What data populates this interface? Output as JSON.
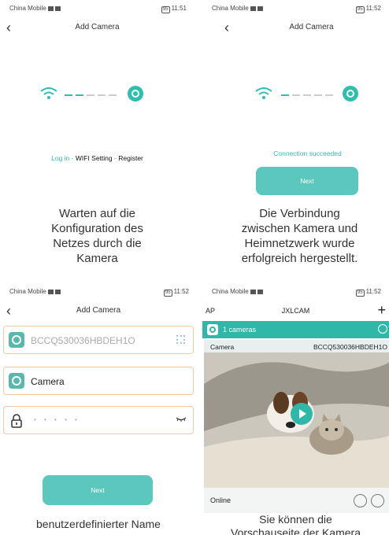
{
  "panel1": {
    "status": {
      "carrier": "China Mobile",
      "time": "11:51",
      "battery": "95"
    },
    "title": "Add Camera",
    "steps": {
      "login": "Log in",
      "wifi": "WIFI Setting",
      "register": "Register",
      "separator": "-"
    },
    "caption": [
      "Warten auf die",
      "Konfiguration des",
      "Netzes durch die",
      "Kamera"
    ]
  },
  "panel2": {
    "status": {
      "carrier": "China Mobile",
      "time": "11:52",
      "battery": "95"
    },
    "title": "Add Camera",
    "message": "Connection succeeded",
    "next": "Next",
    "caption": [
      "Die Verbindung",
      "zwischen Kamera und",
      "Heimnetzwerk wurde",
      "erfolgreich hergestellt."
    ]
  },
  "panel3": {
    "status": {
      "carrier": "China Mobile",
      "time": "11:52",
      "battery": "95"
    },
    "title": "Add Camera",
    "device_id": "BCCQ530036HBDEH1O",
    "camera_name": "Camera",
    "password_mask": "• • • • •",
    "next": "Next",
    "caption": "benutzerdefinierter Name"
  },
  "panel4": {
    "status": {
      "carrier": "China Mobile",
      "time": "11:52",
      "battery": "95"
    },
    "left": "AP",
    "title": "JXLCAM",
    "plus": "+",
    "count": "1 cameras",
    "card": {
      "name": "Camera",
      "id": "BCCQ530036HBDEH1O",
      "state": "Online"
    },
    "caption": [
      "Sie können die",
      "Vorschauseite der Kamera"
    ]
  }
}
